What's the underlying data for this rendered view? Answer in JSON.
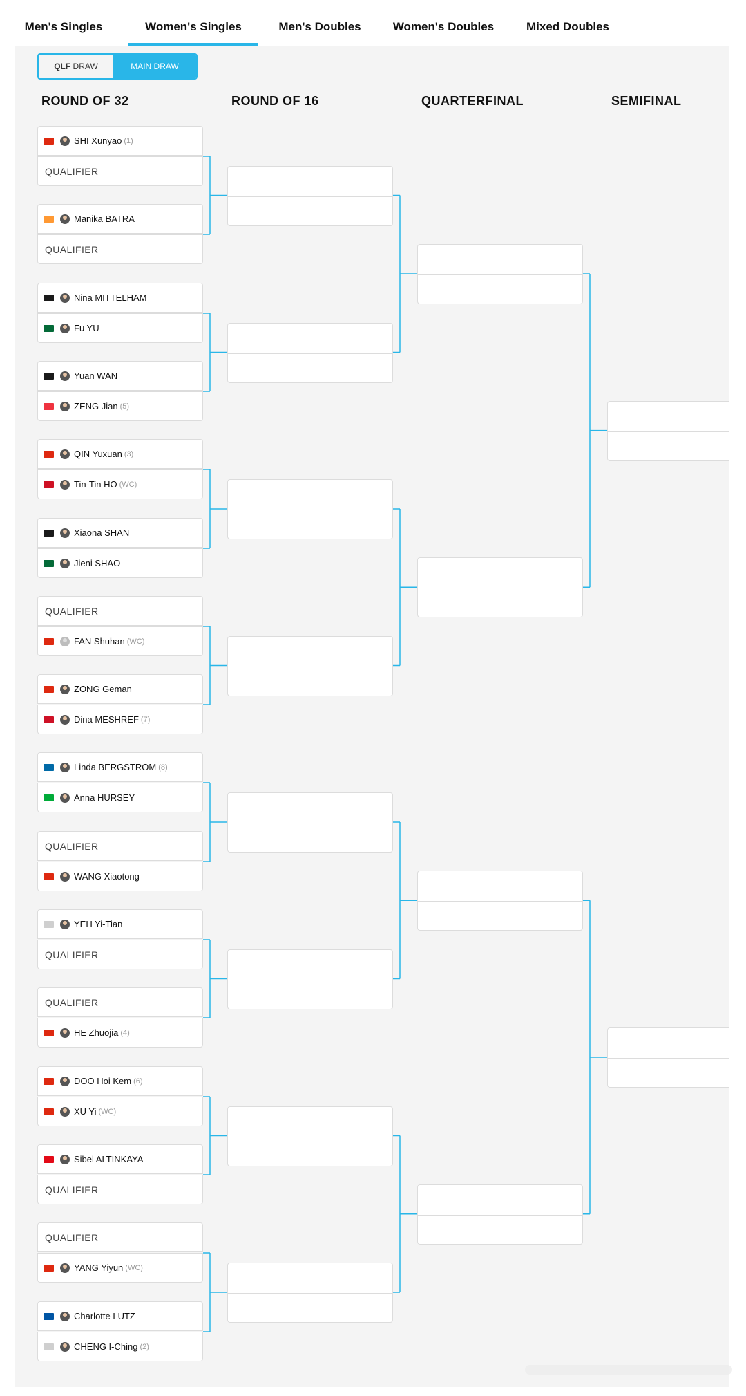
{
  "tabs": [
    {
      "label": "Men's Singles",
      "active": false
    },
    {
      "label": "Women's Singles",
      "active": true
    },
    {
      "label": "Men's Doubles",
      "active": false
    },
    {
      "label": "Women's Doubles",
      "active": false
    },
    {
      "label": "Mixed Doubles",
      "active": false
    }
  ],
  "draw_toggle": {
    "qlf_bold": "QLF",
    "qlf_rest": " DRAW",
    "main": "MAIN DRAW",
    "selected": "MAIN DRAW"
  },
  "rounds": [
    "ROUND OF 32",
    "ROUND OF 16",
    "QUARTERFINAL",
    "SEMIFINAL"
  ],
  "accent_color": "#29b6e8",
  "round_of_32": [
    [
      {
        "name": "SHI Xunyao",
        "seed": "(1)",
        "flag": "CHN"
      },
      {
        "name": "QUALIFIER"
      }
    ],
    [
      {
        "name": "Manika BATRA",
        "seed": "",
        "flag": "IND"
      },
      {
        "name": "QUALIFIER"
      }
    ],
    [
      {
        "name": "Nina MITTELHAM",
        "seed": "",
        "flag": "GER"
      },
      {
        "name": "Fu YU",
        "seed": "",
        "flag": "POR"
      }
    ],
    [
      {
        "name": "Yuan WAN",
        "seed": "",
        "flag": "GER"
      },
      {
        "name": "ZENG Jian",
        "seed": "(5)",
        "flag": "SGP"
      }
    ],
    [
      {
        "name": "QIN Yuxuan",
        "seed": "(3)",
        "flag": "CHN"
      },
      {
        "name": "Tin-Tin HO",
        "seed": "(WC)",
        "flag": "ENG"
      }
    ],
    [
      {
        "name": "Xiaona SHAN",
        "seed": "",
        "flag": "GER"
      },
      {
        "name": "Jieni SHAO",
        "seed": "",
        "flag": "POR"
      }
    ],
    [
      {
        "name": "QUALIFIER"
      },
      {
        "name": "FAN Shuhan",
        "seed": "(WC)",
        "flag": "CHN",
        "avatar": "grey"
      }
    ],
    [
      {
        "name": "ZONG Geman",
        "seed": "",
        "flag": "CHN"
      },
      {
        "name": "Dina MESHREF",
        "seed": "(7)",
        "flag": "EGY"
      }
    ],
    [
      {
        "name": "Linda BERGSTROM",
        "seed": "(8)",
        "flag": "SWE"
      },
      {
        "name": "Anna HURSEY",
        "seed": "",
        "flag": "WAL"
      }
    ],
    [
      {
        "name": "QUALIFIER"
      },
      {
        "name": "WANG Xiaotong",
        "seed": "",
        "flag": "CHN"
      }
    ],
    [
      {
        "name": "YEH Yi-Tian",
        "seed": "",
        "flag": "TPE"
      },
      {
        "name": "QUALIFIER"
      }
    ],
    [
      {
        "name": "QUALIFIER"
      },
      {
        "name": "HE Zhuojia",
        "seed": "(4)",
        "flag": "CHN"
      }
    ],
    [
      {
        "name": "DOO Hoi Kem",
        "seed": "(6)",
        "flag": "HKG"
      },
      {
        "name": "XU Yi",
        "seed": "(WC)",
        "flag": "CHN"
      }
    ],
    [
      {
        "name": "Sibel ALTINKAYA",
        "seed": "",
        "flag": "TUR"
      },
      {
        "name": "QUALIFIER"
      }
    ],
    [
      {
        "name": "QUALIFIER"
      },
      {
        "name": "YANG Yiyun",
        "seed": "(WC)",
        "flag": "CHN"
      }
    ],
    [
      {
        "name": "Charlotte LUTZ",
        "seed": "",
        "flag": "FRA"
      },
      {
        "name": "CHENG I-Ching",
        "seed": "(2)",
        "flag": "TPE"
      }
    ]
  ],
  "flag_colors": {
    "CHN": "#de2910",
    "IND": "#ff9933",
    "GER": "#1a1a1a",
    "POR": "#046a38",
    "SGP": "#ef3340",
    "ENG": "#ce1124",
    "EGY": "#ce1126",
    "SWE": "#006aa7",
    "WAL": "#00ab39",
    "TPE": "#cfcfcf",
    "HKG": "#de2910",
    "TUR": "#e30a17",
    "FRA": "#0055a4"
  }
}
